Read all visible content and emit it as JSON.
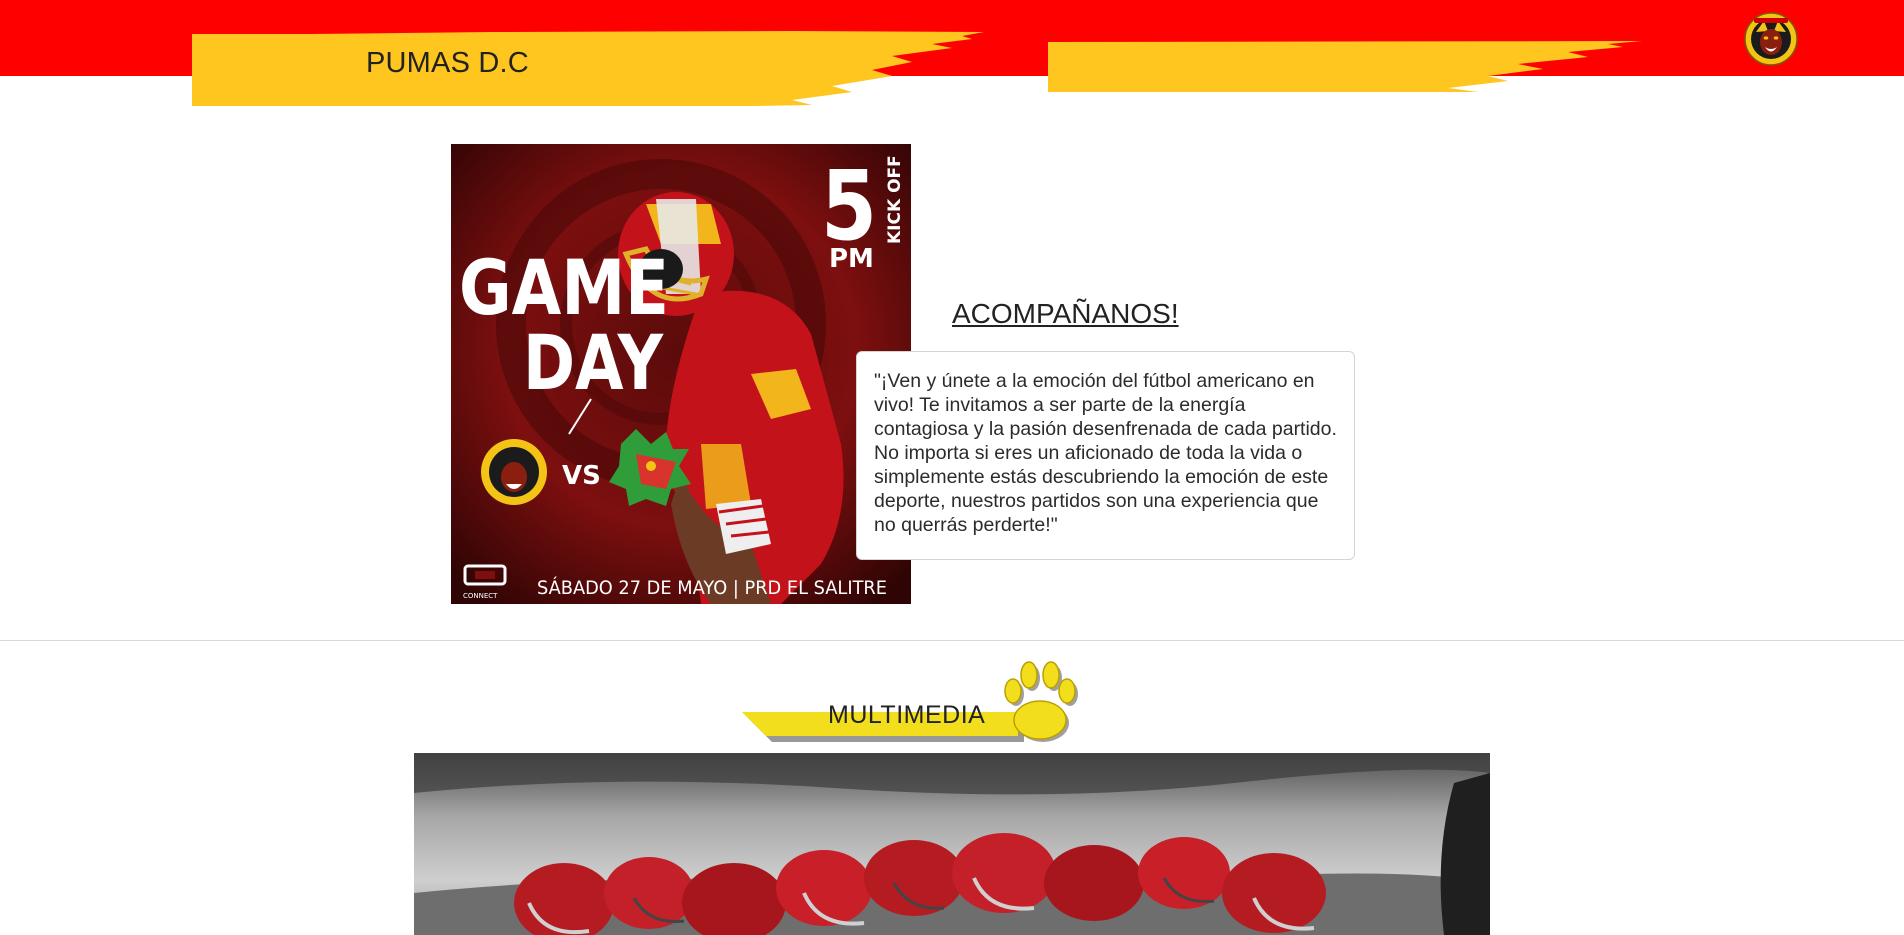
{
  "header": {
    "brand": "PUMAS D.C",
    "logo_icon": "pumas-crest-icon",
    "colors": {
      "band": "#ff0000",
      "brush": "#ffc61f"
    }
  },
  "hero": {
    "poster": {
      "headline_line1": "GAME",
      "headline_line2": "DAY",
      "kickoff_hour": "5",
      "kickoff_meridiem": "PM",
      "kickoff_label": "KICK OFF",
      "versus": "VS",
      "footer_text": "SÁBADO 27 DE MAYO | PRD EL SALITRE",
      "sponsor": "CONNECT"
    },
    "title": "ACOMPAÑANOS!",
    "quote": "\"¡Ven y únete a la emoción del fútbol americano en vivo! Te invitamos a ser parte de la energía contagiosa y la pasión desenfrenada de cada partido. No importa si eres un aficionado de toda la vida o simplemente estás descubriendo la emoción de este deporte, nuestros partidos son una experiencia que no querrás perderte!\""
  },
  "multimedia": {
    "title": "MULTIMEDIA",
    "icon": "paw-icon",
    "banner_color": "#f2de1c"
  }
}
